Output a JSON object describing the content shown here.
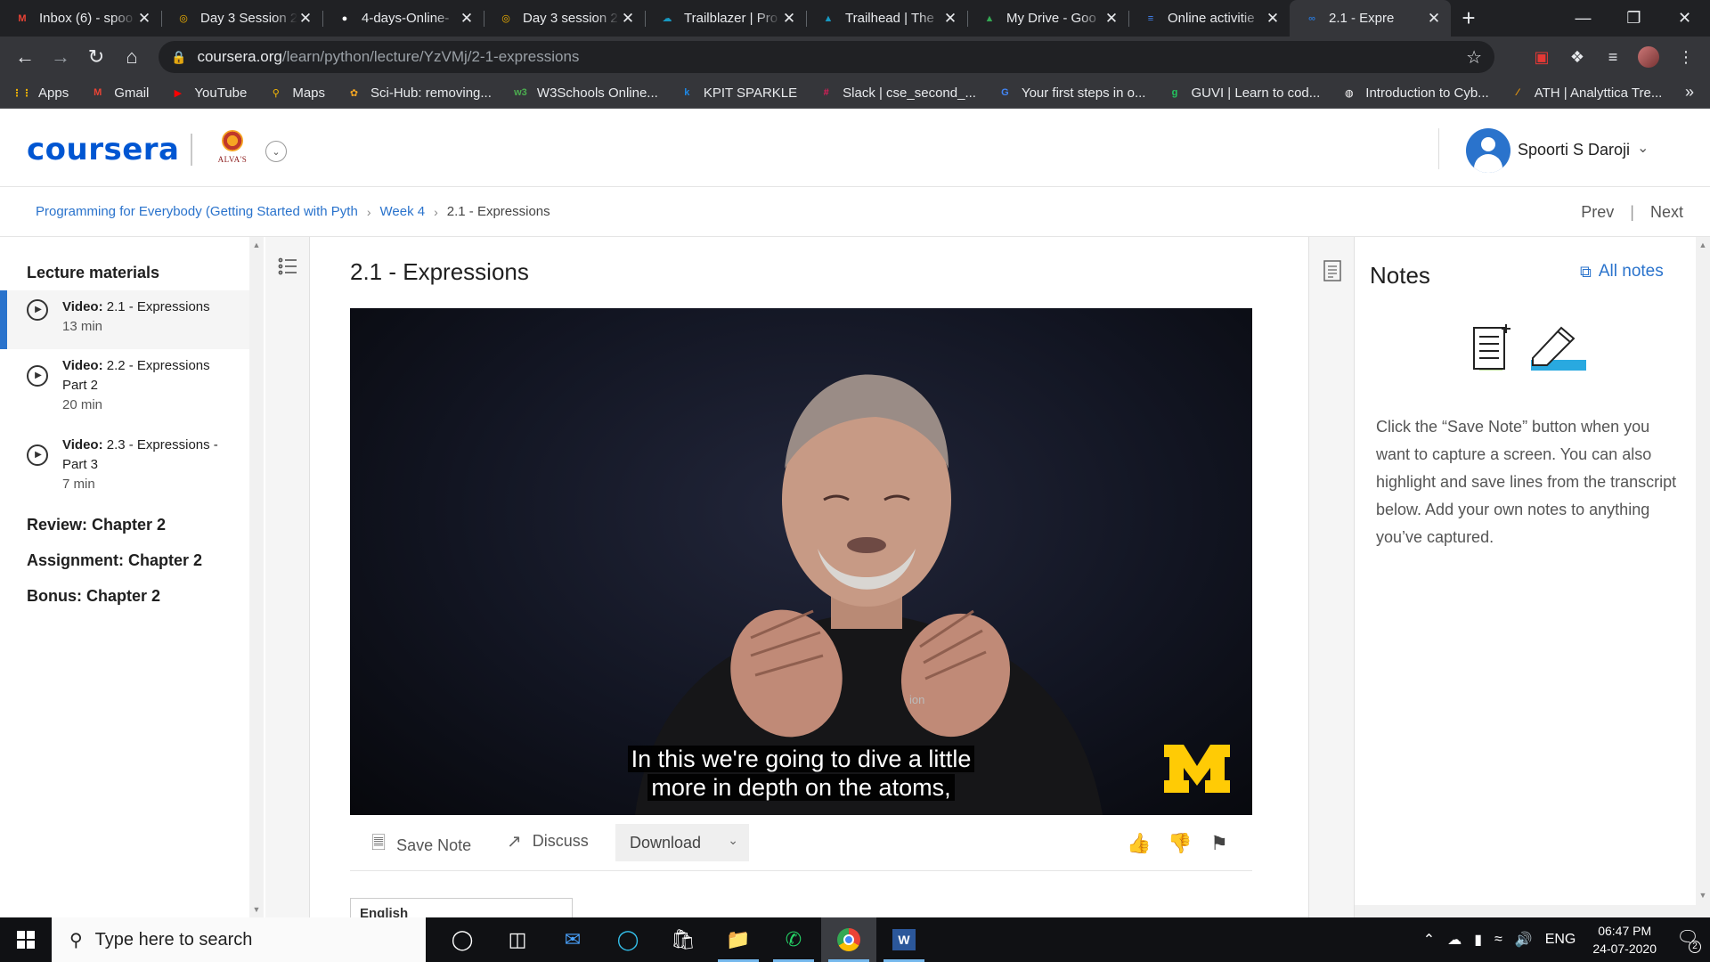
{
  "browser": {
    "tabs": [
      {
        "title": "Inbox (6) - spoo",
        "icon": "gmail-icon",
        "color": "#ea4335",
        "glyph": "M"
      },
      {
        "title": "Day 3 Session 2",
        "icon": "loading-icon",
        "color": "#f4b400",
        "glyph": "◎"
      },
      {
        "title": "4-days-Online-",
        "icon": "github-icon",
        "color": "#ffffff",
        "glyph": "●"
      },
      {
        "title": "Day 3 session 2",
        "icon": "loading-icon",
        "color": "#f4b400",
        "glyph": "◎"
      },
      {
        "title": "Trailblazer | Pro",
        "icon": "salesforce-icon",
        "color": "#1798c1",
        "glyph": "☁"
      },
      {
        "title": "Trailhead | The",
        "icon": "trailhead-icon",
        "color": "#1798c1",
        "glyph": "▲"
      },
      {
        "title": "My Drive - Goo",
        "icon": "google-drive-icon",
        "color": "#34a853",
        "glyph": "▲"
      },
      {
        "title": "Online activitie",
        "icon": "google-docs-icon",
        "color": "#4285f4",
        "glyph": "≡"
      },
      {
        "title": "2.1 - Expre",
        "icon": "coursera-icon",
        "color": "#2a73cc",
        "glyph": "∞",
        "active": true
      }
    ],
    "new_tab": "+",
    "url_host": "coursera.org",
    "url_path": "/learn/python/lecture/YzVMj/2-1-expressions",
    "bookmarks": [
      {
        "label": "Apps",
        "icon": "apps-grid-icon",
        "color": "#f4b400",
        "glyph": "⋮⋮"
      },
      {
        "label": "Gmail",
        "icon": "gmail-icon",
        "color": "#ea4335",
        "glyph": "M"
      },
      {
        "label": "YouTube",
        "icon": "youtube-icon",
        "color": "#ff0000",
        "glyph": "▶"
      },
      {
        "label": "Maps",
        "icon": "maps-icon",
        "color": "#fbbc04",
        "glyph": "⚲"
      },
      {
        "label": "Sci-Hub: removing...",
        "icon": "scihub-icon",
        "color": "#f4a623",
        "glyph": "✿"
      },
      {
        "label": "W3Schools Online...",
        "icon": "w3schools-icon",
        "color": "#4caf50",
        "glyph": "w3"
      },
      {
        "label": "KPIT SPARKLE",
        "icon": "kpit-icon",
        "color": "#1e88e5",
        "glyph": "k"
      },
      {
        "label": "Slack | cse_second_...",
        "icon": "slack-icon",
        "color": "#e01e5a",
        "glyph": "#"
      },
      {
        "label": "Your first steps in o...",
        "icon": "google-icon",
        "color": "#4285f4",
        "glyph": "G"
      },
      {
        "label": "GUVI | Learn to cod...",
        "icon": "guvi-icon",
        "color": "#22c55e",
        "glyph": "g"
      },
      {
        "label": "Introduction to Cyb...",
        "icon": "globe-icon",
        "color": "#ffffff",
        "glyph": "◍"
      },
      {
        "label": "ATH | Analyttica Tre...",
        "icon": "ath-icon",
        "color": "#f59e0b",
        "glyph": "⁄"
      }
    ]
  },
  "header": {
    "logo": "coursera",
    "partner_text": "ALVA'S",
    "user_name": "Spoorti S Daroji"
  },
  "breadcrumb": {
    "course": "Programming for Everybody (Getting Started with Pyth",
    "week": "Week 4",
    "current": "2.1 - Expressions",
    "prev": "Prev",
    "next": "Next"
  },
  "sidebar": {
    "title": "Lecture materials",
    "lessons": [
      {
        "kind": "Video:",
        "title": "2.1 - Expressions",
        "duration": "13 min",
        "active": true
      },
      {
        "kind": "Video:",
        "title": "2.2 - Expressions Part 2",
        "duration": "20 min"
      },
      {
        "kind": "Video:",
        "title": "2.3 - Expressions - Part 3",
        "duration": "7 min"
      }
    ],
    "sections": [
      "Review: Chapter 2",
      "Assignment: Chapter 2",
      "Bonus: Chapter 2"
    ]
  },
  "main": {
    "title": "2.1 - Expressions",
    "caption_line1": "In this we're going to dive a little",
    "caption_line2": "more in depth on the atoms,",
    "video_watermark": "ion",
    "save_note": "Save Note",
    "discuss": "Discuss",
    "download": "Download",
    "language": "English"
  },
  "notes": {
    "title": "Notes",
    "all_notes": "All notes",
    "help": "Click the “Save Note” button when you want to capture a screen. You can also highlight and save lines from the transcript below. Add your own notes to anything you’ve captured."
  },
  "taskbar": {
    "search_placeholder": "Type here to search",
    "language": "ENG",
    "time": "06:47 PM",
    "date": "24-07-2020",
    "notifications": "2"
  },
  "colors": {
    "coursera_blue": "#0056d2",
    "link_blue": "#2a73cc",
    "chrome_dark": "#202124",
    "chrome_toolbar": "#35363a"
  }
}
